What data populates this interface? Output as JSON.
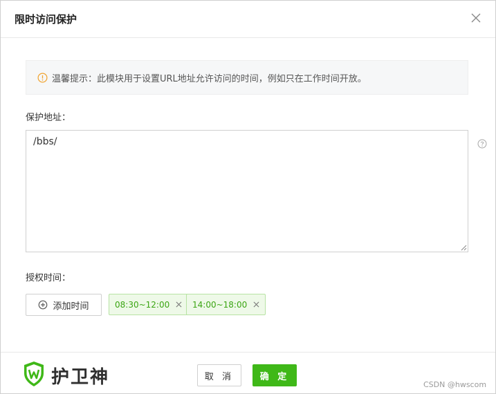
{
  "dialog": {
    "title": "限时访问保护"
  },
  "tip": {
    "text": "温馨提示：此模块用于设置URL地址允许访问的时间，例如只在工作时间开放。"
  },
  "address": {
    "label": "保护地址：",
    "value": "/bbs/"
  },
  "auth_time": {
    "label": "授权时间：",
    "add_button_label": "添加时间",
    "tags": [
      {
        "label": "08:30~12:00"
      },
      {
        "label": "14:00~18:00"
      }
    ]
  },
  "footer": {
    "brand": "护卫神",
    "cancel_label": "取 消",
    "ok_label": "确 定"
  },
  "watermark": "CSDN @hwscom",
  "colors": {
    "accent": "#3fb818",
    "tag_text": "#3aa512",
    "warning": "#f0a32f"
  },
  "icons": {
    "close": "close-icon",
    "tip": "warning-circle-icon",
    "help": "question-circle-icon",
    "add": "plus-circle-icon",
    "logo": "shield-logo-icon"
  }
}
